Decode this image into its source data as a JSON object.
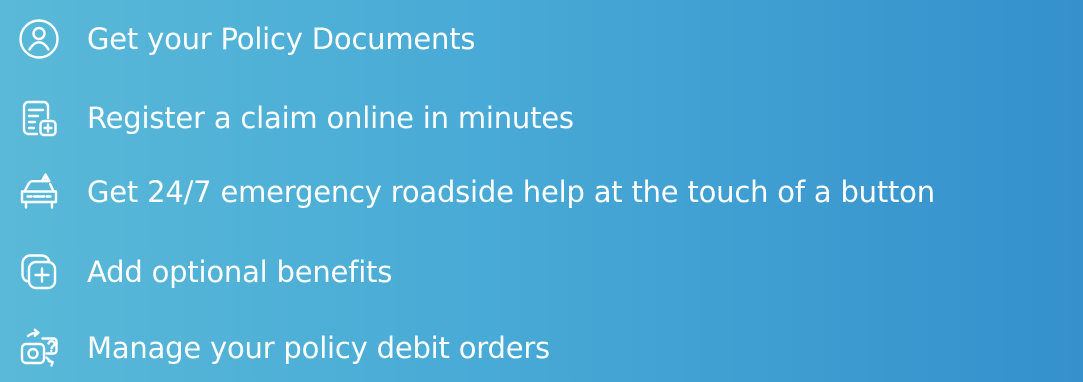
{
  "features": [
    {
      "icon": "user-circle-icon",
      "label": "Get your Policy Documents"
    },
    {
      "icon": "document-plus-icon",
      "label": "Register a claim online in minutes"
    },
    {
      "icon": "car-alert-icon",
      "label": "Get 24/7 emergency roadside help at the touch of a button"
    },
    {
      "icon": "add-benefit-icon",
      "label": "Add optional benefits"
    },
    {
      "icon": "debit-order-icon",
      "label": "Manage your policy debit orders"
    }
  ],
  "colors": {
    "background_start": "#5ab9d8",
    "background_end": "#3590cc",
    "text": "#ffffff",
    "icon_stroke": "#ffffff"
  }
}
